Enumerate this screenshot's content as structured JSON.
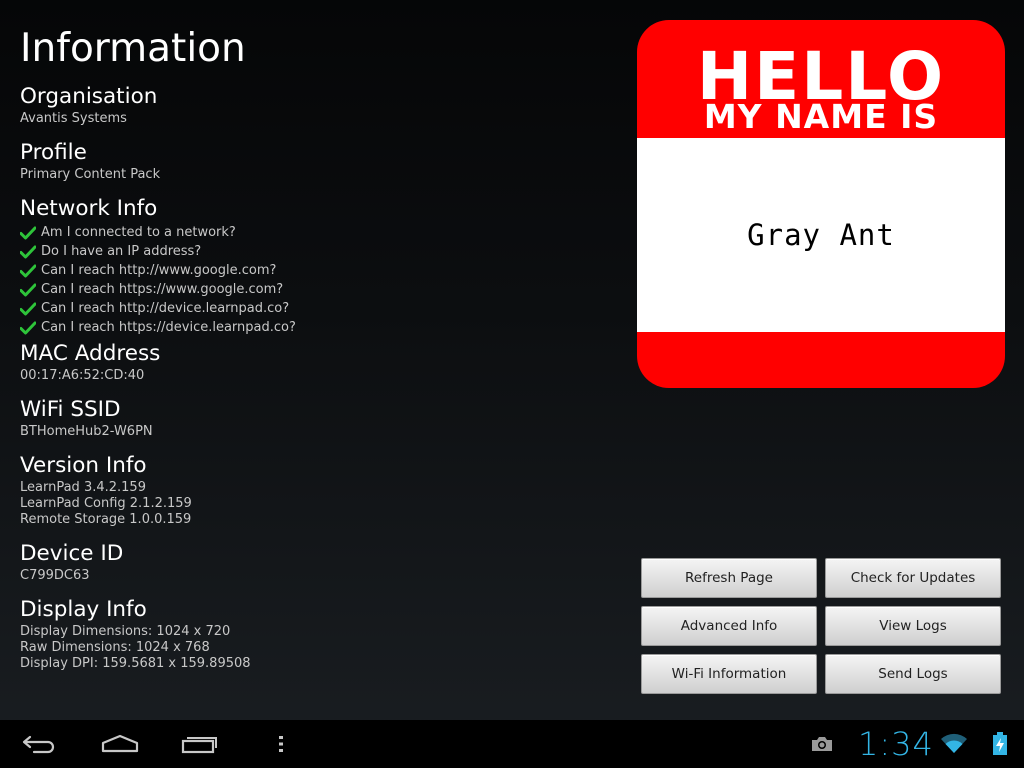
{
  "info": {
    "title": "Information",
    "sections": [
      {
        "title": "Organisation",
        "lines": [
          "Avantis Systems"
        ]
      },
      {
        "title": "Profile",
        "lines": [
          "Primary Content Pack"
        ]
      },
      {
        "title": "Network Info",
        "checks": [
          "Am I connected to a network?",
          "Do I have an IP address?",
          "Can I reach http://www.google.com?",
          "Can I reach https://www.google.com?",
          "Can I reach http://device.learnpad.co?",
          "Can I reach https://device.learnpad.co?"
        ]
      },
      {
        "title": "MAC Address",
        "lines": [
          "00:17:A6:52:CD:40"
        ]
      },
      {
        "title": "WiFi SSID",
        "lines": [
          "BTHomeHub2-W6PN"
        ]
      },
      {
        "title": "Version Info",
        "lines": [
          "LearnPad 3.4.2.159",
          "LearnPad Config 2.1.2.159",
          "Remote Storage 1.0.0.159"
        ]
      },
      {
        "title": "Device ID",
        "lines": [
          "C799DC63"
        ]
      },
      {
        "title": "Display Info",
        "lines": [
          "Display Dimensions: 1024 x 720",
          "Raw Dimensions: 1024 x 768",
          "Display DPI: 159.5681 x 159.89508"
        ]
      }
    ]
  },
  "name_tag": {
    "hello": "HELLO",
    "my_name_is": "MY NAME IS",
    "name": "Gray Ant",
    "colors": {
      "red": "#ff0000",
      "white": "#ffffff"
    }
  },
  "buttons": {
    "refresh": "Refresh Page",
    "check_updates": "Check for Updates",
    "advanced_info": "Advanced Info",
    "view_logs": "View Logs",
    "wifi_info": "Wi-Fi Information",
    "send_logs": "Send Logs"
  },
  "system_bar": {
    "time": "1:34",
    "nav_icons": [
      "back-icon",
      "home-icon",
      "recent-apps-icon",
      "menu-icon"
    ],
    "status_icons": [
      "camera-icon",
      "wifi-icon",
      "battery-charging-icon"
    ],
    "accent_color": "#33b5e5",
    "check_color": "#2ec43a"
  }
}
